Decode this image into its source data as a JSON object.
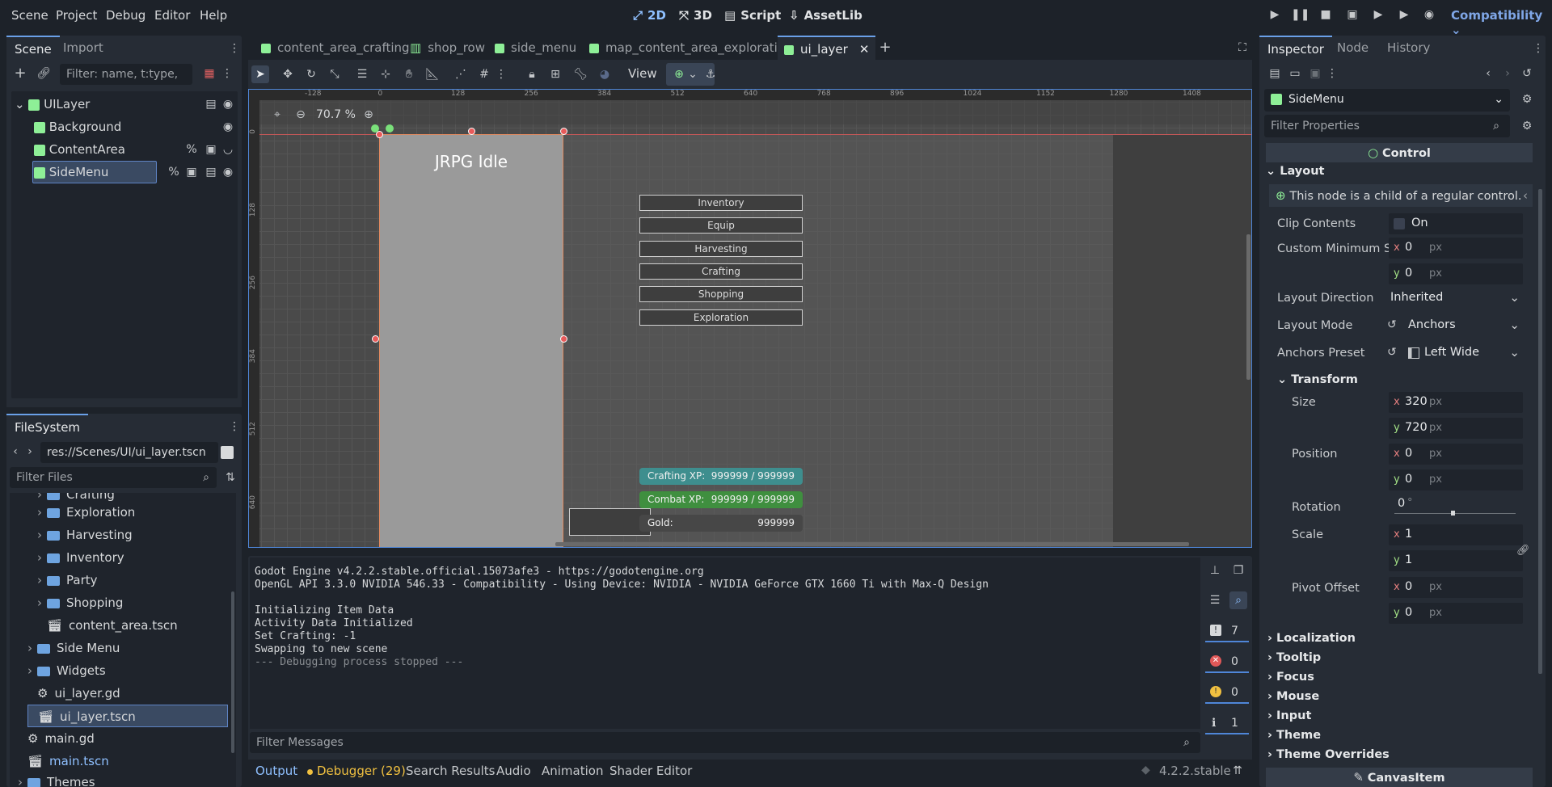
{
  "menu": [
    "Scene",
    "Project",
    "Debug",
    "Editor",
    "Help"
  ],
  "workspaces": {
    "w2d": "2D",
    "w3d": "3D",
    "script": "Script",
    "assetlib": "AssetLib"
  },
  "renderer": "Compatibility",
  "scene_dock": {
    "tabs": [
      "Scene",
      "Import"
    ],
    "filter_placeholder": "Filter: name, t:type, g",
    "nodes": [
      {
        "name": "UILayer",
        "level": 0
      },
      {
        "name": "Background",
        "level": 1
      },
      {
        "name": "ContentArea",
        "level": 1
      },
      {
        "name": "SideMenu",
        "level": 1,
        "selected": true
      }
    ]
  },
  "filesystem": {
    "tab": "FileSystem",
    "path": "res://Scenes/UI/ui_layer.tscn",
    "filter_placeholder": "Filter Files",
    "items": [
      {
        "name": "Crafting",
        "kind": "folder",
        "level": 2
      },
      {
        "name": "Exploration",
        "kind": "folder",
        "level": 2
      },
      {
        "name": "Harvesting",
        "kind": "folder",
        "level": 2
      },
      {
        "name": "Inventory",
        "kind": "folder",
        "level": 2
      },
      {
        "name": "Party",
        "kind": "folder",
        "level": 2
      },
      {
        "name": "Shopping",
        "kind": "folder",
        "level": 2
      },
      {
        "name": "content_area.tscn",
        "kind": "scene",
        "level": 2
      },
      {
        "name": "Side Menu",
        "kind": "folder",
        "level": 1
      },
      {
        "name": "Widgets",
        "kind": "folder",
        "level": 1
      },
      {
        "name": "ui_layer.gd",
        "kind": "script",
        "level": 1
      },
      {
        "name": "ui_layer.tscn",
        "kind": "scene",
        "level": 1,
        "selected": true
      },
      {
        "name": "main.gd",
        "kind": "script",
        "level": 0
      },
      {
        "name": "main.tscn",
        "kind": "scene",
        "level": 0
      },
      {
        "name": "Themes",
        "kind": "folder",
        "level": 0
      }
    ]
  },
  "scene_tabs": [
    "content_area_crafting",
    "shop_row",
    "side_menu",
    "map_content_area_exploration",
    "ui_layer"
  ],
  "toolbar": {
    "view": "View",
    "zoom": "70.7 %"
  },
  "ruler_labels": [
    "-128",
    "0",
    "128",
    "256",
    "384",
    "512",
    "640",
    "768",
    "896",
    "1024",
    "1152",
    "1280",
    "1408"
  ],
  "ruler_v_labels": [
    "0",
    "128",
    "256",
    "384",
    "512",
    "640"
  ],
  "game_preview": {
    "title": "JRPG Idle",
    "buttons": [
      "Inventory",
      "Equip",
      "Harvesting",
      "Crafting",
      "Shopping",
      "Exploration"
    ],
    "stats": [
      {
        "label": "Crafting XP:",
        "value": "999999 / 999999",
        "color": "#3e8e8e"
      },
      {
        "label": "Combat XP:",
        "value": "999999 / 999999",
        "color": "#3f8f3f"
      },
      {
        "label": "Gold:",
        "value": "999999",
        "color": "#474747"
      }
    ]
  },
  "output": {
    "lines": [
      "Godot Engine v4.2.2.stable.official.15073afe3 - https://godotengine.org",
      "OpenGL API 3.3.0 NVIDIA 546.33 - Compatibility - Using Device: NVIDIA - NVIDIA GeForce GTX 1660 Ti with Max-Q Design",
      "",
      "Initializing Item Data",
      "Activity Data Initialized",
      "Set Crafting: -1",
      "Swapping to new scene",
      "--- Debugging process stopped ---"
    ],
    "filter_placeholder": "Filter Messages",
    "counts": {
      "messages": "7",
      "errors": "0",
      "warnings": "0",
      "info": "1"
    }
  },
  "bottom_tabs": [
    "Output",
    "Debugger (29)",
    "Search Results",
    "Audio",
    "Animation",
    "Shader Editor"
  ],
  "version": "4.2.2.stable",
  "inspector": {
    "tabs": [
      "Inspector",
      "Node",
      "History"
    ],
    "node": "SideMenu",
    "filter_placeholder": "Filter Properties",
    "class": "Control",
    "layout": "Layout",
    "warning": "This node is a child of a regular control.",
    "clip_contents": {
      "label": "Clip Contents",
      "value": "On"
    },
    "custom_min_size": {
      "label": "Custom Minimum Si...",
      "x": "0",
      "y": "0"
    },
    "layout_direction": {
      "label": "Layout Direction",
      "value": "Inherited"
    },
    "layout_mode": {
      "label": "Layout Mode",
      "value": "Anchors"
    },
    "anchors_preset": {
      "label": "Anchors Preset",
      "value": "Left Wide"
    },
    "transform": "Transform",
    "size": {
      "label": "Size",
      "x": "320",
      "y": "720"
    },
    "position": {
      "label": "Position",
      "x": "0",
      "y": "0"
    },
    "rotation": {
      "label": "Rotation",
      "value": "0",
      "unit": "°"
    },
    "scale": {
      "label": "Scale",
      "x": "1",
      "y": "1"
    },
    "pivot_offset": {
      "label": "Pivot Offset",
      "x": "0",
      "y": "0"
    },
    "unit_px": "px",
    "sections": [
      "Localization",
      "Tooltip",
      "Focus",
      "Mouse",
      "Input",
      "Theme",
      "Theme Overrides"
    ],
    "footer": "CanvasItem"
  }
}
